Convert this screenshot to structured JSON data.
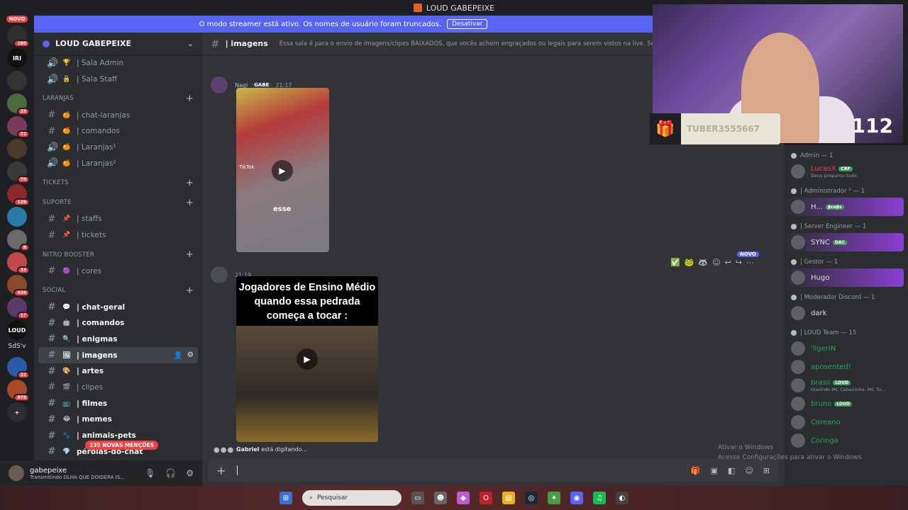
{
  "window": {
    "title": "LOUD GABEPEIXE"
  },
  "guilds": {
    "novo_label": "NOVO",
    "items": [
      {
        "badge": "180",
        "color": "#2f2f2f"
      },
      {
        "badge": "",
        "color": "#111111",
        "text": "IRI"
      },
      {
        "badge": "",
        "color": "#333333"
      },
      {
        "badge": "25",
        "color": "#4b6b3a"
      },
      {
        "badge": "72",
        "color": "#7a3a5a"
      },
      {
        "badge": "",
        "color": "#4a3a2a"
      },
      {
        "badge": "70",
        "color": "#3a3a3a"
      },
      {
        "badge": "126",
        "color": "#8a2a2a"
      },
      {
        "badge": "",
        "color": "#2a7aa8"
      },
      {
        "badge": "8",
        "color": "#6a6a6a"
      },
      {
        "badge": "33",
        "color": "#c24a4a"
      },
      {
        "badge": "436",
        "color": "#8a4a2a"
      },
      {
        "badge": "17",
        "color": "#5a3a6a"
      },
      {
        "badge": "",
        "color": "#111111",
        "text": "LOUD"
      }
    ],
    "sdsv_label": "SdS'v",
    "items2": [
      {
        "badge": "32",
        "color": "#2a5aa8"
      },
      {
        "badge": "878",
        "color": "#a84a2a"
      }
    ]
  },
  "streamer_bar": {
    "text": "O modo streamer está ativo. Os nomes de usuário foram truncados.",
    "button": "Desativar"
  },
  "server": {
    "name": "LOUD GABEPEIXE"
  },
  "channels": [
    {
      "kind": "channel",
      "icon": "🔊",
      "emoji": "🏆",
      "label": "| Sala Admin",
      "state": "normal"
    },
    {
      "kind": "channel",
      "icon": "🔊",
      "emoji": "🔒",
      "label": "| Sala Staff",
      "state": "normal"
    },
    {
      "kind": "category",
      "label": "LARANJAS"
    },
    {
      "kind": "channel",
      "icon": "#",
      "emoji": "🍊",
      "label": "| chat-laranjas",
      "state": "normal"
    },
    {
      "kind": "channel",
      "icon": "#",
      "emoji": "🍊",
      "label": "| comandos",
      "state": "normal"
    },
    {
      "kind": "channel",
      "icon": "🔊",
      "emoji": "🍊",
      "label": "| Laranjas¹",
      "state": "normal"
    },
    {
      "kind": "channel",
      "icon": "🔊",
      "emoji": "🍊",
      "label": "| Laranjas²",
      "state": "normal"
    },
    {
      "kind": "category",
      "label": "TICKETS"
    },
    {
      "kind": "category",
      "label": "SUPORTE"
    },
    {
      "kind": "channel",
      "icon": "#",
      "emoji": "📌",
      "label": "| staffs",
      "state": "normal"
    },
    {
      "kind": "channel",
      "icon": "#",
      "emoji": "📌",
      "label": "| tickets",
      "state": "normal"
    },
    {
      "kind": "category",
      "label": "NITRO BOOSTER"
    },
    {
      "kind": "channel",
      "icon": "#",
      "emoji": "🟣",
      "label": "| cores",
      "state": "normal"
    },
    {
      "kind": "category",
      "label": "SOCIAL"
    },
    {
      "kind": "channel",
      "icon": "#",
      "emoji": "💬",
      "label": "| chat-geral",
      "state": "unread"
    },
    {
      "kind": "channel",
      "icon": "#",
      "emoji": "🤖",
      "label": "| comandos",
      "state": "unread"
    },
    {
      "kind": "channel",
      "icon": "#",
      "emoji": "🔍",
      "label": "| enigmas",
      "state": "unread"
    },
    {
      "kind": "channel",
      "icon": "#",
      "emoji": "🖼",
      "label": "| imagens",
      "state": "active"
    },
    {
      "kind": "channel",
      "icon": "#",
      "emoji": "🎨",
      "label": "| artes",
      "state": "unread"
    },
    {
      "kind": "channel",
      "icon": "#",
      "emoji": "🎬",
      "label": "| clipes",
      "state": "normal"
    },
    {
      "kind": "channel",
      "icon": "#",
      "emoji": "📺",
      "label": "| filmes",
      "state": "unread"
    },
    {
      "kind": "channel",
      "icon": "#",
      "emoji": "😂",
      "label": "| memes",
      "state": "unread"
    },
    {
      "kind": "channel",
      "icon": "#",
      "emoji": "🐾",
      "label": "| animais-pets",
      "state": "unread"
    },
    {
      "kind": "channel",
      "icon": "#",
      "emoji": "💎",
      "label": "pérolas-do-chat",
      "state": "unread"
    }
  ],
  "mentions_pill": "235 NOVAS MENÇÕES",
  "user": {
    "name": "gabepeixe",
    "status": "Transmitindo OLHA QUE DOIDERA IS..."
  },
  "chat": {
    "channel_title": "| imagens",
    "topic": "Essa sala é para o envio de imagens/clipes BAIXADOS, que vocês achem engraçados ou legais para serem vistos na live. Serão apaga",
    "msg1": {
      "name": "Nagi",
      "tag": "GABE",
      "time": "21:17",
      "wm": "TikTok",
      "caption": "esse"
    },
    "msg2": {
      "time": "21:19",
      "caption": "Jogadores de Ensino Médio quando essa pedrada começa a tocar :"
    },
    "novo_pill": "NOVO",
    "typing_user": "Gabriel",
    "typing_text": " está digitando..."
  },
  "stream_overlay": {
    "viewers": "112",
    "gift_user": "TUBER3555667"
  },
  "members": {
    "roles": [
      {
        "label": "Admin — 1",
        "members": [
          {
            "name": "LucasX",
            "tag": "CRF",
            "sub": "Deus preparou tudo.",
            "color": "#f23f42",
            "hl": false
          }
        ]
      },
      {
        "label": "| Administrador ² — 1",
        "members": [
          {
            "name": "H...",
            "tag": "βcoβs",
            "sub": "",
            "color": "#dbdee1",
            "hl": true
          }
        ]
      },
      {
        "label": "| Server Engineer — 1",
        "members": [
          {
            "name": "SYNC",
            "tag": "DAC",
            "sub": "",
            "color": "#dbdee1",
            "hl": true
          }
        ]
      },
      {
        "label": "| Gestor — 1",
        "members": [
          {
            "name": "Hugo",
            "tag": "",
            "sub": "",
            "color": "#dbdee1",
            "hl": true
          }
        ]
      },
      {
        "label": "| Moderador Discord — 1",
        "members": [
          {
            "name": "dark",
            "tag": "",
            "sub": "",
            "color": "#dbdee1",
            "hl": false
          }
        ]
      },
      {
        "label": "| LOUD Team — 15",
        "members": [
          {
            "name": "'ligeriN",
            "tag": "",
            "sub": "",
            "color": "#23a55a",
            "hl": false
          },
          {
            "name": "aposented!",
            "tag": "",
            "sub": "",
            "color": "#23a55a",
            "hl": false
          },
          {
            "name": "brasil",
            "tag": "LOUD",
            "sub": "Ouvindo MC Cebezinho, MC Tu...",
            "color": "#23a55a",
            "hl": false
          },
          {
            "name": "bruno",
            "tag": "LOUD",
            "sub": "",
            "color": "#23a55a",
            "hl": false
          },
          {
            "name": "Coreano",
            "tag": "",
            "sub": "",
            "color": "#23a55a",
            "hl": false
          },
          {
            "name": "Coringa",
            "tag": "",
            "sub": "",
            "color": "#23a55a",
            "hl": false
          }
        ]
      }
    ]
  },
  "watermark": {
    "line1": "Ativar o Windows",
    "line2": "Acesse Configurações para ativar o Windows."
  },
  "taskbar": {
    "search_placeholder": "Pesquisar"
  },
  "colors": {
    "accent": "#5865f2",
    "mention": "#f23f42",
    "online": "#23a55a"
  }
}
